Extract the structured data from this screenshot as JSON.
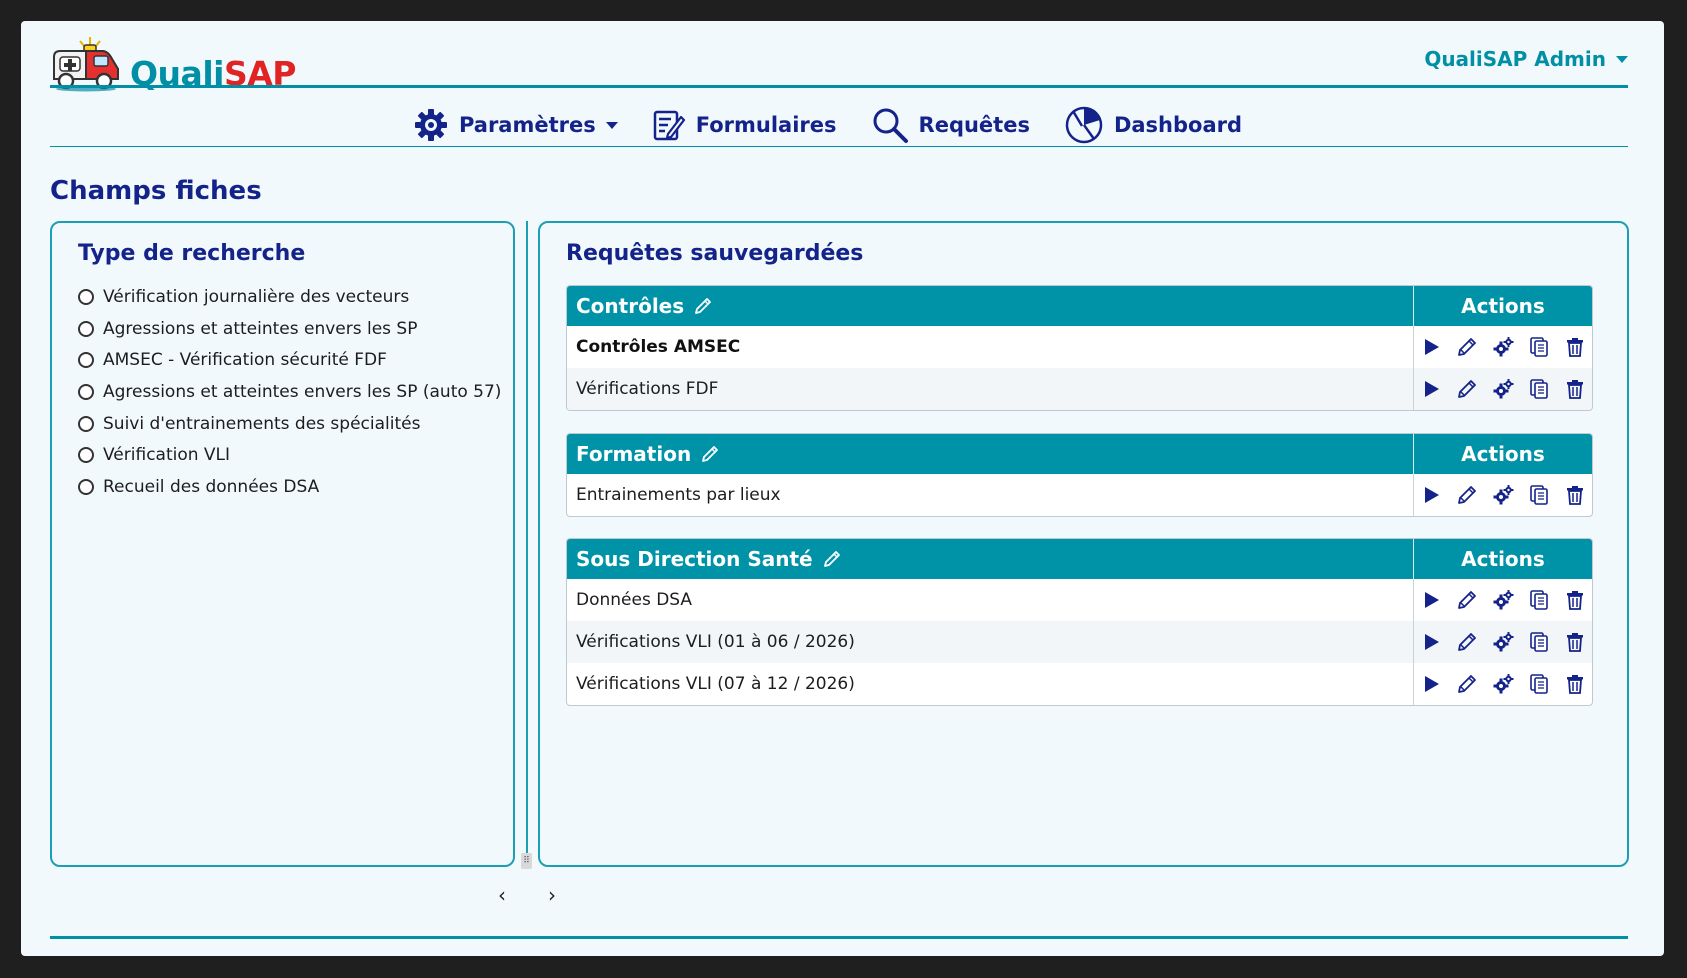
{
  "header": {
    "logo": {
      "part1": "Quali",
      "part2": "SAP"
    },
    "user_menu_label": "QualiSAP Admin"
  },
  "nav": {
    "items": [
      {
        "label": "Paramètres",
        "icon": "gear-icon",
        "has_dropdown": true
      },
      {
        "label": "Formulaires",
        "icon": "form-icon"
      },
      {
        "label": "Requêtes",
        "icon": "search-icon"
      },
      {
        "label": "Dashboard",
        "icon": "dashboard-icon"
      }
    ]
  },
  "page_title": "Champs fiches",
  "search_type": {
    "title": "Type de recherche",
    "options": [
      "Vérification journalière des vecteurs",
      "Agressions et atteintes envers les SP",
      "AMSEC - Vérification sécurité FDF",
      "Agressions et atteintes envers les SP (auto 57)",
      "Suivi d'entrainements des spécialités",
      "Vérification VLI",
      "Recueil des données DSA"
    ]
  },
  "saved_queries": {
    "title": "Requêtes sauvegardées",
    "actions_label": "Actions",
    "groups": [
      {
        "name": "Contrôles",
        "rows": [
          "Contrôles AMSEC",
          "Vérifications FDF"
        ]
      },
      {
        "name": "Formation",
        "rows": [
          "Entrainements par lieux"
        ]
      },
      {
        "name": "Sous Direction Santé",
        "rows": [
          "Données DSA",
          "Vérifications VLI (01 à 06 / 2026)",
          "Vérifications VLI (07 à 12 / 2026)"
        ]
      }
    ],
    "row_action_icons": [
      "play-icon",
      "pencil-icon",
      "gears-icon",
      "copy-icon",
      "trash-icon"
    ]
  },
  "pager": {
    "prev": "‹",
    "next": "›"
  },
  "colors": {
    "accent": "#008fa5",
    "primary": "#14238a",
    "logo_red": "#e02424",
    "table_header": "#0093a8"
  }
}
